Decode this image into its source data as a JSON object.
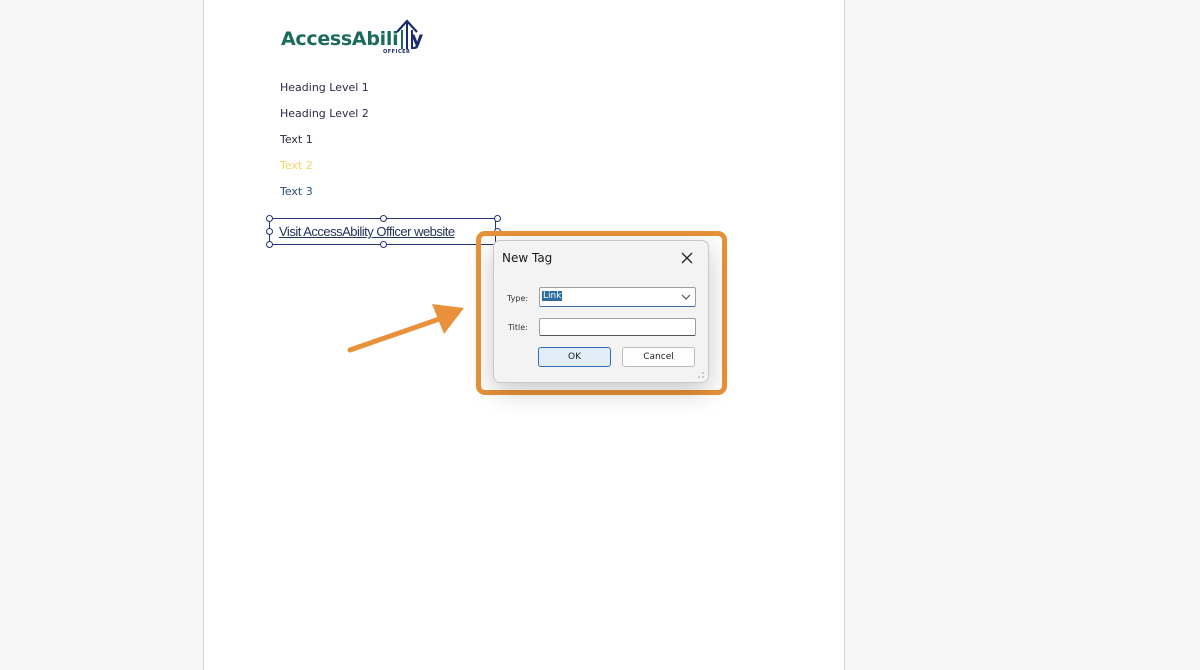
{
  "logo": {
    "text_green": "AccessAbili",
    "text_dark": "y",
    "subtitle": "OFFICER"
  },
  "document": {
    "lines": [
      "Heading Level 1",
      "Heading Level 2",
      "Text 1",
      "Text 2",
      "Text 3"
    ],
    "link_text": "Visit AccessAbility Officer website"
  },
  "dialog": {
    "title": "New Tag",
    "type_label": "Type:",
    "type_value": "Link",
    "title_label": "Title:",
    "title_value": "",
    "ok_label": "OK",
    "cancel_label": "Cancel"
  },
  "colors": {
    "highlight": "#e8913a",
    "logo_green": "#1a6b5c",
    "logo_navy": "#1b2a6b",
    "link": "#22335e"
  },
  "icons": [
    "close-icon",
    "chevron-down-icon",
    "resize-grip-icon",
    "arrow-annotation",
    "house-icon"
  ]
}
